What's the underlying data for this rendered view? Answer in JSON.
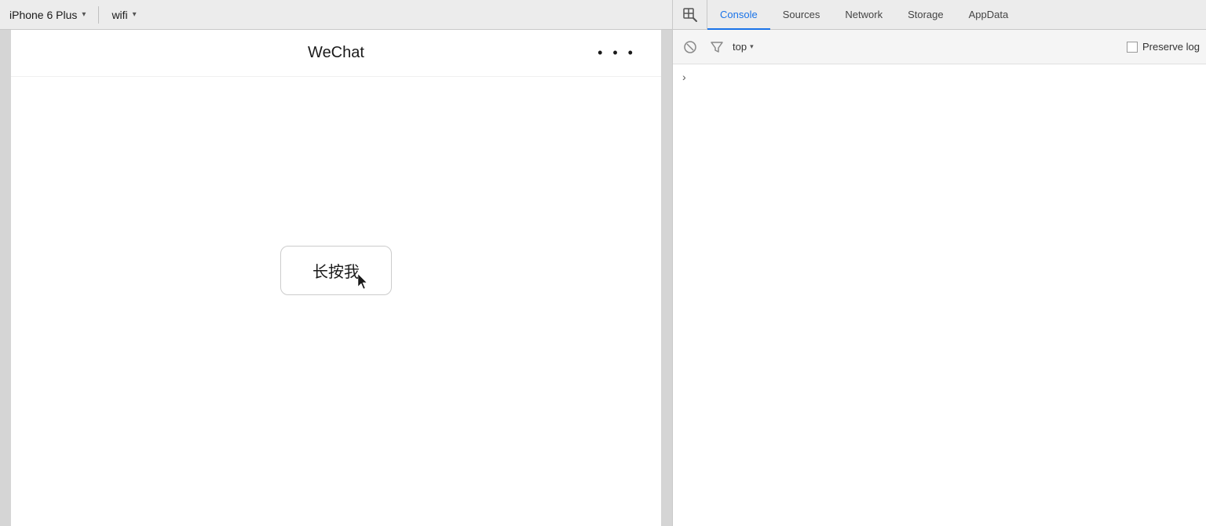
{
  "topbar": {
    "device_name": "iPhone 6 Plus",
    "dropdown_arrow": "▾",
    "wifi_name": "wifi",
    "wifi_arrow": "▾"
  },
  "devtools": {
    "tabs": [
      {
        "id": "console",
        "label": "Console",
        "active": true
      },
      {
        "id": "sources",
        "label": "Sources",
        "active": false
      },
      {
        "id": "network",
        "label": "Network",
        "active": false
      },
      {
        "id": "storage",
        "label": "Storage",
        "active": false
      },
      {
        "id": "appdata",
        "label": "AppData",
        "active": false
      }
    ],
    "console_toolbar": {
      "clear_icon": "🚫",
      "filter_icon": "⊿",
      "context_label": "top",
      "context_arrow": "▾",
      "preserve_label": "Preserve log"
    },
    "console_body": {
      "prompt_chevron": "›"
    }
  },
  "simulator": {
    "app_title": "WeChat",
    "app_menu": "• • •",
    "long_press_button_label": "长按我"
  }
}
